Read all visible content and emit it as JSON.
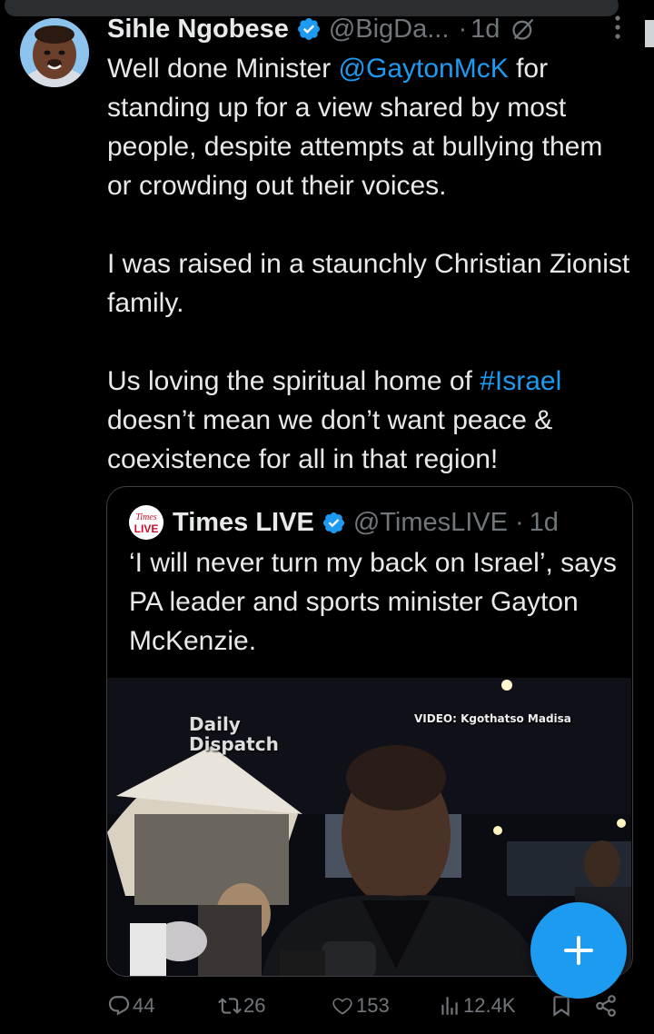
{
  "tweet": {
    "author_name": "Sihle Ngobese",
    "author_handle": "@BigDa...",
    "separator": "·",
    "time": "1d",
    "text_parts": {
      "p1_a": "Well done Minister ",
      "p1_mention": "@GaytonMcK",
      "p1_b": " for standing up for a view shared by most people, despite attempts at bullying them or crowding out their voices.",
      "p2": "I was raised in a staunchly Christian Zionist family.",
      "p3_a": "Us loving the spiritual home of ",
      "p3_hashtag": "#Israel",
      "p3_b": " doesn’t mean we don’t want peace & coexistence for all in that region!"
    }
  },
  "quote": {
    "logo_text_top": "Times",
    "logo_text_bottom": "LIVE",
    "author_name": "Times LIVE",
    "author_handle": "@TimesLIVE",
    "separator": "·",
    "time": "1d",
    "text": "‘I will never turn my back on Israel’, says PA leader and sports minister Gayton McKenzie.",
    "video": {
      "watermark_left_line1": "Daily",
      "watermark_left_line2": "Dispatch",
      "watermark_right": "VIDEO: Kgothatso Madisa"
    }
  },
  "actions": {
    "replies": "44",
    "reposts": "26",
    "likes": "153",
    "views": "12.4K"
  },
  "icons": {
    "verified": "verified-badge-icon",
    "grok": "grok-icon",
    "more": "more-vertical-icon",
    "reply": "reply-icon",
    "repost": "repost-icon",
    "like": "heart-icon",
    "views": "views-chart-icon",
    "bookmark": "bookmark-icon",
    "share": "share-icon",
    "compose": "plus-icon"
  },
  "colors": {
    "background": "#000000",
    "text": "#e7e9ea",
    "secondary": "#71767b",
    "accent": "#1d9bf0",
    "border": "#3e4144"
  }
}
